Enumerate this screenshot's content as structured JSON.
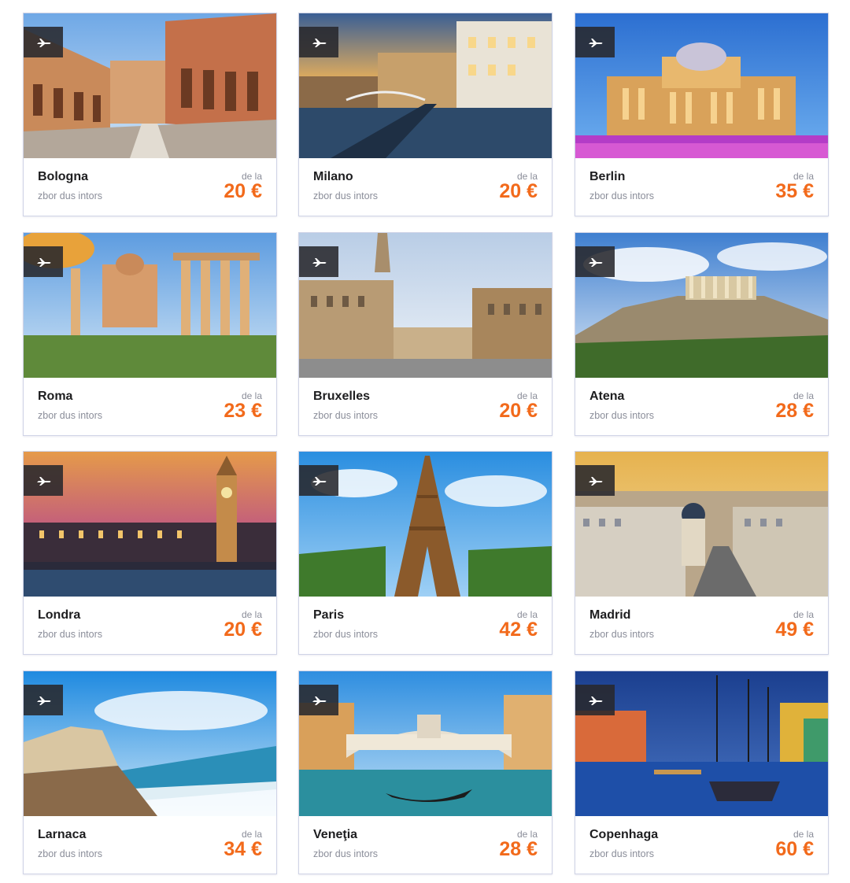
{
  "accent_color": "#f26a1b",
  "badge_icon": "plane-icon",
  "destinations": [
    {
      "city": "Bologna",
      "subtitle": "zbor dus intors",
      "from_label": "de la",
      "price": "20 €",
      "image": "bologna-piazza-photo"
    },
    {
      "city": "Milano",
      "subtitle": "zbor dus intors",
      "from_label": "de la",
      "price": "20 €",
      "image": "milano-naviglio-photo"
    },
    {
      "city": "Berlin",
      "subtitle": "zbor dus intors",
      "from_label": "de la",
      "price": "35 €",
      "image": "berlin-reichstag-photo"
    },
    {
      "city": "Roma",
      "subtitle": "zbor dus intors",
      "from_label": "de la",
      "price": "23 €",
      "image": "roma-forum-photo"
    },
    {
      "city": "Bruxelles",
      "subtitle": "zbor dus intors",
      "from_label": "de la",
      "price": "20 €",
      "image": "bruxelles-grand-place-photo"
    },
    {
      "city": "Atena",
      "subtitle": "zbor dus intors",
      "from_label": "de la",
      "price": "28 €",
      "image": "atena-acropolis-photo"
    },
    {
      "city": "Londra",
      "subtitle": "zbor dus intors",
      "from_label": "de la",
      "price": "20 €",
      "image": "londra-big-ben-photo"
    },
    {
      "city": "Paris",
      "subtitle": "zbor dus intors",
      "from_label": "de la",
      "price": "42 €",
      "image": "paris-eiffel-photo"
    },
    {
      "city": "Madrid",
      "subtitle": "zbor dus intors",
      "from_label": "de la",
      "price": "49 €",
      "image": "madrid-gran-via-photo"
    },
    {
      "city": "Larnaca",
      "subtitle": "zbor dus intors",
      "from_label": "de la",
      "price": "34 €",
      "image": "larnaca-beach-photo"
    },
    {
      "city": "Veneţia",
      "subtitle": "zbor dus intors",
      "from_label": "de la",
      "price": "28 €",
      "image": "venetia-rialto-photo"
    },
    {
      "city": "Copenhaga",
      "subtitle": "zbor dus intors",
      "from_label": "de la",
      "price": "60 €",
      "image": "copenhaga-nyhavn-photo"
    }
  ]
}
